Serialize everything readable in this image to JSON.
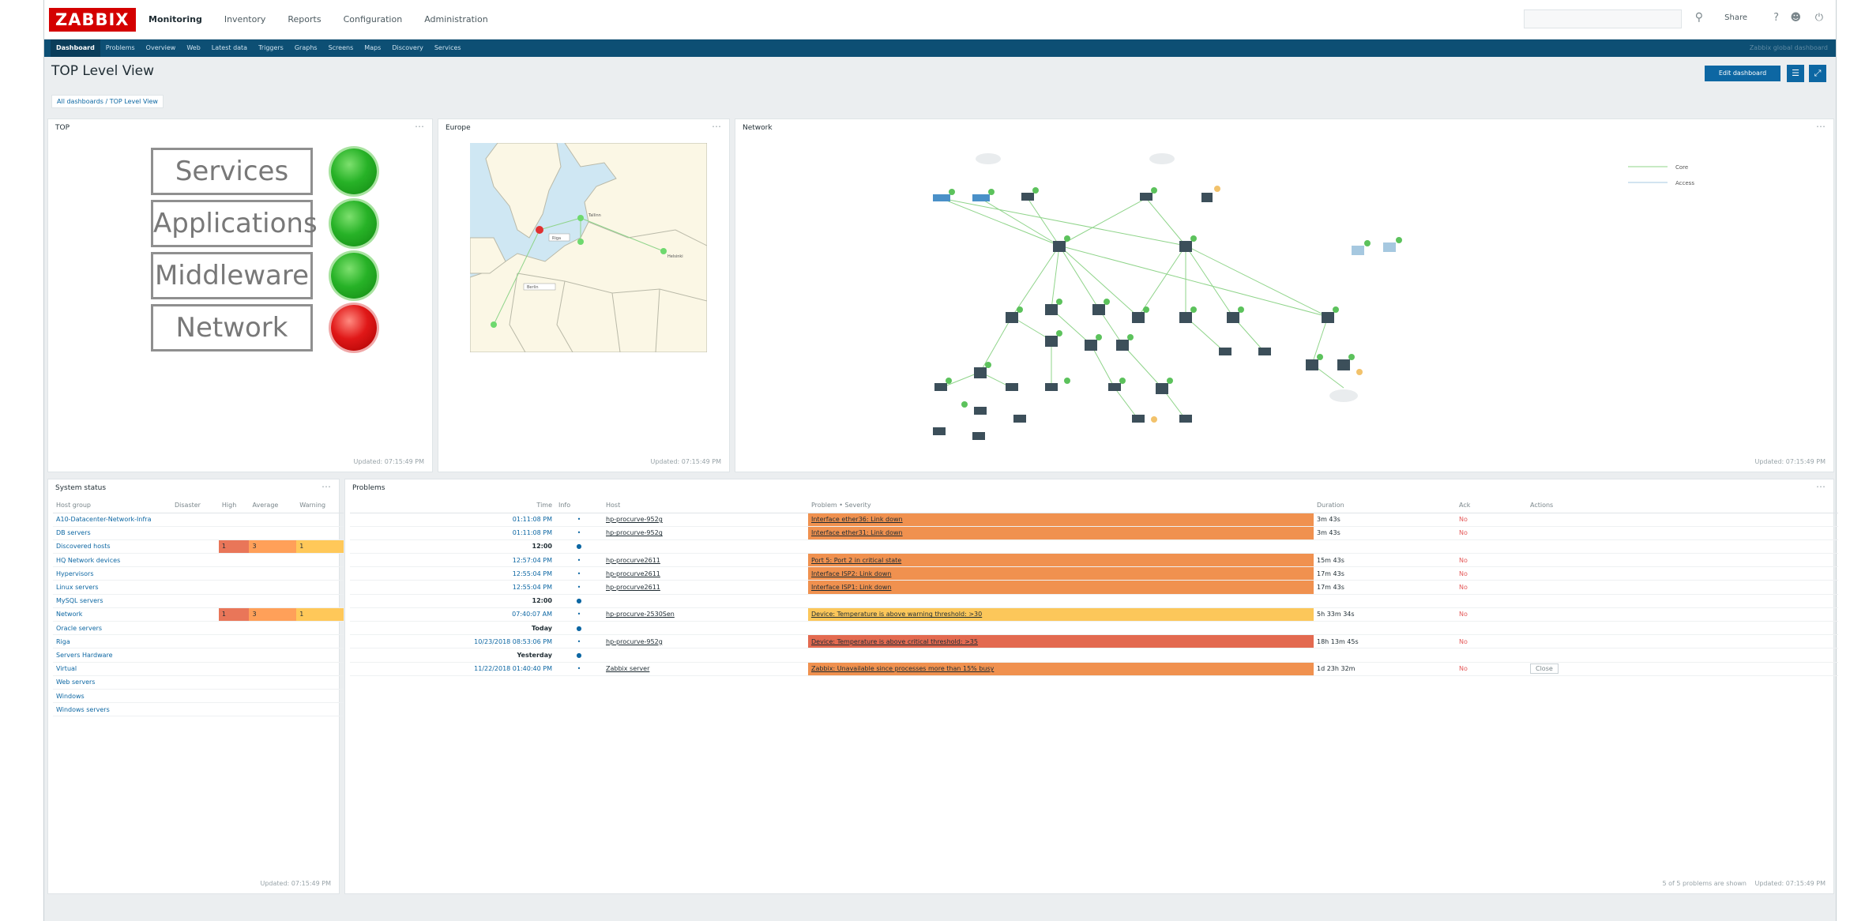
{
  "header": {
    "logo": "ZABBIX",
    "menu": [
      "Monitoring",
      "Inventory",
      "Reports",
      "Configuration",
      "Administration"
    ],
    "share_label": "Share",
    "help_icon": "question-icon",
    "user_icon": "user-icon",
    "power_icon": "power-icon"
  },
  "subnav": {
    "items": [
      "Dashboard",
      "Problems",
      "Overview",
      "Web",
      "Latest data",
      "Triggers",
      "Graphs",
      "Screens",
      "Maps",
      "Discovery",
      "Services"
    ],
    "right_text": "Zabbix global dashboard"
  },
  "page": {
    "title": "TOP Level View",
    "breadcrumb": "All dashboards / TOP Level View",
    "edit_button": "Edit dashboard"
  },
  "top_widget": {
    "title": "TOP",
    "updated": "Updated: 07:15:49 PM",
    "rows": [
      {
        "label": "Services",
        "status": "green"
      },
      {
        "label": "Applications",
        "status": "green"
      },
      {
        "label": "Middleware",
        "status": "green"
      },
      {
        "label": "Network",
        "status": "red"
      }
    ]
  },
  "europe_widget": {
    "title": "Europe",
    "updated": "Updated: 07:15:49 PM",
    "labels": [
      "Riga",
      "Tallinn",
      "Helsinki",
      "Berlin"
    ]
  },
  "network_widget": {
    "title": "Network",
    "updated": "Updated: 07:15:49 PM",
    "legend": [
      "Core",
      "Access"
    ]
  },
  "system_status": {
    "title": "System status",
    "updated": "Updated: 07:15:49 PM",
    "headers": [
      "Host group",
      "Disaster",
      "High",
      "Average",
      "Warning"
    ],
    "rows": [
      {
        "group": "A10-Datacenter-Network-Infra",
        "high": "",
        "avg": "",
        "warn": ""
      },
      {
        "group": "DB servers",
        "high": "",
        "avg": "",
        "warn": ""
      },
      {
        "group": "Discovered hosts",
        "high": "1",
        "avg": "3",
        "warn": "1"
      },
      {
        "group": "HQ Network devices",
        "high": "",
        "avg": "",
        "warn": ""
      },
      {
        "group": "Hypervisors",
        "high": "",
        "avg": "",
        "warn": ""
      },
      {
        "group": "Linux servers",
        "high": "",
        "avg": "",
        "warn": ""
      },
      {
        "group": "MySQL servers",
        "high": "",
        "avg": "",
        "warn": ""
      },
      {
        "group": "Network",
        "high": "1",
        "avg": "3",
        "warn": "1"
      },
      {
        "group": "Oracle servers",
        "high": "",
        "avg": "",
        "warn": ""
      },
      {
        "group": "Riga",
        "high": "",
        "avg": "",
        "warn": ""
      },
      {
        "group": "Servers Hardware",
        "high": "",
        "avg": "",
        "warn": ""
      },
      {
        "group": "Virtual",
        "high": "",
        "avg": "",
        "warn": ""
      },
      {
        "group": "Web servers",
        "high": "",
        "avg": "",
        "warn": ""
      },
      {
        "group": "Windows",
        "high": "",
        "avg": "",
        "warn": ""
      },
      {
        "group": "Windows servers",
        "high": "",
        "avg": "",
        "warn": ""
      }
    ]
  },
  "problems": {
    "title": "Problems",
    "footer": "5 of 5 problems are shown",
    "updated": "Updated: 07:15:49 PM",
    "headers": [
      "Time",
      "Info",
      "Host",
      "Problem • Severity",
      "Duration",
      "Ack",
      "Actions"
    ],
    "rows": [
      {
        "kind": "p",
        "time": "01:11:08 PM",
        "host": "hp-procurve-952g",
        "problem": "Interface ether36: Link down",
        "sev": "high",
        "duration": "3m 43s",
        "ack": "No",
        "action": ""
      },
      {
        "kind": "p",
        "time": "01:11:08 PM",
        "host": "hp-procurve-952g",
        "problem": "Interface ether31: Link down",
        "sev": "high",
        "duration": "3m 43s",
        "ack": "No",
        "action": ""
      },
      {
        "kind": "d",
        "time": "12:00"
      },
      {
        "kind": "p",
        "time": "12:57:04 PM",
        "host": "hp-procurve2611",
        "problem": "Port 5: Port 2 in critical state",
        "sev": "high",
        "duration": "15m 43s",
        "ack": "No",
        "action": ""
      },
      {
        "kind": "p",
        "time": "12:55:04 PM",
        "host": "hp-procurve2611",
        "problem": "Interface ISP2: Link down",
        "sev": "high",
        "duration": "17m 43s",
        "ack": "No",
        "action": ""
      },
      {
        "kind": "p",
        "time": "12:55:04 PM",
        "host": "hp-procurve2611",
        "problem": "Interface ISP1: Link down",
        "sev": "high",
        "duration": "17m 43s",
        "ack": "No",
        "action": ""
      },
      {
        "kind": "d",
        "time": "12:00"
      },
      {
        "kind": "p",
        "time": "07:40:07 AM",
        "host": "hp-procurve-2530Sen",
        "problem": "Device: Temperature is above warning threshold: >30",
        "sev": "warn",
        "duration": "5h 33m 34s",
        "ack": "No",
        "action": ""
      },
      {
        "kind": "d",
        "time": "Today"
      },
      {
        "kind": "p",
        "time": "10/23/2018 08:53:06 PM",
        "host": "hp-procurve-952g",
        "problem": "Device: Temperature is above critical threshold: >35",
        "sev": "dis",
        "duration": "18h 13m 45s",
        "ack": "No",
        "action": ""
      },
      {
        "kind": "d",
        "time": "Yesterday"
      },
      {
        "kind": "p",
        "time": "11/22/2018 01:40:40 PM",
        "host": "Zabbix server",
        "problem": "Zabbix: Unavailable since processes more than 15% busy",
        "sev": "high",
        "duration": "1d 23h 32m",
        "ack": "No",
        "action": "Close"
      }
    ]
  }
}
